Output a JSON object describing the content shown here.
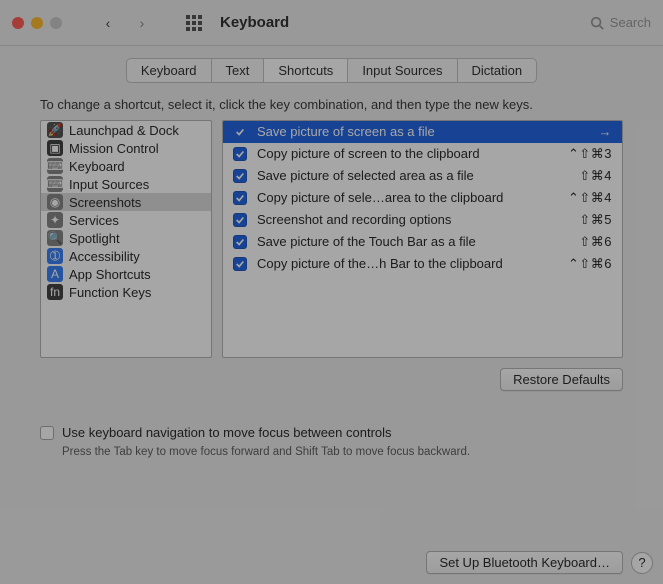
{
  "window": {
    "title": "Keyboard"
  },
  "search": {
    "placeholder": "Search"
  },
  "tabs": [
    "Keyboard",
    "Text",
    "Shortcuts",
    "Input Sources",
    "Dictation"
  ],
  "active_tab_index": 2,
  "instruction": "To change a shortcut, select it, click the key combination, and then type the new keys.",
  "categories": [
    {
      "label": "Launchpad & Dock",
      "icon": "🚀"
    },
    {
      "label": "Mission Control",
      "icon": "▣"
    },
    {
      "label": "Keyboard",
      "icon": "⌨"
    },
    {
      "label": "Input Sources",
      "icon": "⌨"
    },
    {
      "label": "Screenshots",
      "icon": "◉"
    },
    {
      "label": "Services",
      "icon": "✦"
    },
    {
      "label": "Spotlight",
      "icon": "🔍"
    },
    {
      "label": "Accessibility",
      "icon": "➀"
    },
    {
      "label": "App Shortcuts",
      "icon": "A"
    },
    {
      "label": "Function Keys",
      "icon": "fn"
    }
  ],
  "selected_category_index": 4,
  "shortcuts": [
    {
      "checked": true,
      "label": "Save picture of screen as a file",
      "keys": "→",
      "selected": true
    },
    {
      "checked": true,
      "label": "Copy picture of screen to the clipboard",
      "keys": "⌃⇧⌘3"
    },
    {
      "checked": true,
      "label": "Save picture of selected area as a file",
      "keys": "⇧⌘4"
    },
    {
      "checked": true,
      "label": "Copy picture of sele…area to the clipboard",
      "keys": "⌃⇧⌘4"
    },
    {
      "checked": true,
      "label": "Screenshot and recording options",
      "keys": "⇧⌘5"
    },
    {
      "checked": true,
      "label": "Save picture of the Touch Bar as a file",
      "keys": "⇧⌘6"
    },
    {
      "checked": true,
      "label": "Copy picture of the…h Bar to the clipboard",
      "keys": "⌃⇧⌘6"
    }
  ],
  "buttons": {
    "restore": "Restore Defaults",
    "bluetooth": "Set Up Bluetooth Keyboard…"
  },
  "keyboard_nav": {
    "label": "Use keyboard navigation to move focus between controls",
    "hint": "Press the Tab key to move focus forward and Shift Tab to move focus backward.",
    "checked": false
  },
  "help_label": "?"
}
